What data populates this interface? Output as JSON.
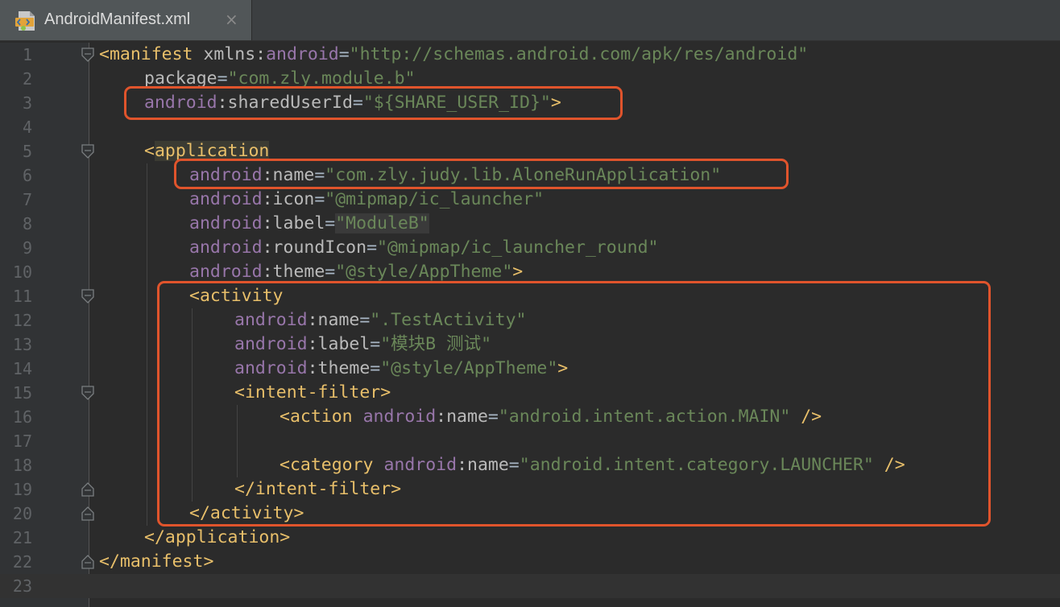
{
  "tab": {
    "label": "AndroidManifest.xml",
    "close": "×",
    "icon": "android-manifest-file-icon"
  },
  "colors": {
    "tag": "#e8bf6a",
    "namespace": "#9876aa",
    "attribute": "#bababa",
    "string": "#6a8759",
    "highlight_box": "#e0542c"
  },
  "lines": [
    {
      "num": "1",
      "indent": 0,
      "fold": "open",
      "tokens": [
        [
          "<manifest",
          "t"
        ],
        [
          " xmlns:",
          "a"
        ],
        [
          "android",
          "n"
        ],
        [
          "=",
          "p"
        ],
        [
          "\"http://schemas.android.com/apk/res/android\"",
          "s"
        ]
      ]
    },
    {
      "num": "2",
      "indent": 1,
      "fold": "",
      "tokens": [
        [
          "package",
          "a"
        ],
        [
          "=",
          "p"
        ],
        [
          "\"com.zly.module.b\"",
          "s"
        ]
      ]
    },
    {
      "num": "3",
      "indent": 1,
      "fold": "",
      "tokens": [
        [
          "android",
          "n"
        ],
        [
          ":sharedUserId",
          "a"
        ],
        [
          "=",
          "p"
        ],
        [
          "\"${SHARE_USER_ID}\"",
          "s"
        ],
        [
          ">",
          "t"
        ]
      ]
    },
    {
      "num": "4",
      "indent": 0,
      "fold": "",
      "tokens": []
    },
    {
      "num": "5",
      "indent": 1,
      "fold": "open",
      "tokens": [
        [
          "<",
          "t"
        ],
        [
          "application",
          "t hl-tag"
        ]
      ]
    },
    {
      "num": "6",
      "indent": 2,
      "fold": "",
      "tokens": [
        [
          "android",
          "n"
        ],
        [
          ":name",
          "a"
        ],
        [
          "=",
          "p"
        ],
        [
          "\"com.zly.judy.lib.AloneRunApplication\"",
          "s"
        ]
      ]
    },
    {
      "num": "7",
      "indent": 2,
      "fold": "",
      "tokens": [
        [
          "android",
          "n"
        ],
        [
          ":icon",
          "a"
        ],
        [
          "=",
          "p"
        ],
        [
          "\"@mipmap/ic_launcher\"",
          "s"
        ]
      ]
    },
    {
      "num": "8",
      "indent": 2,
      "fold": "",
      "tokens": [
        [
          "android",
          "n"
        ],
        [
          ":label",
          "a"
        ],
        [
          "=",
          "p"
        ],
        [
          "\"ModuleB\"",
          "s hl-str"
        ]
      ]
    },
    {
      "num": "9",
      "indent": 2,
      "fold": "",
      "tokens": [
        [
          "android",
          "n"
        ],
        [
          ":roundIcon",
          "a"
        ],
        [
          "=",
          "p"
        ],
        [
          "\"@mipmap/ic_launcher_round\"",
          "s"
        ]
      ]
    },
    {
      "num": "10",
      "indent": 2,
      "fold": "",
      "tokens": [
        [
          "android",
          "n"
        ],
        [
          ":theme",
          "a"
        ],
        [
          "=",
          "p"
        ],
        [
          "\"@style/AppTheme\"",
          "s"
        ],
        [
          ">",
          "t"
        ]
      ]
    },
    {
      "num": "11",
      "indent": 2,
      "fold": "open",
      "tokens": [
        [
          "<activity",
          "t"
        ]
      ]
    },
    {
      "num": "12",
      "indent": 3,
      "fold": "",
      "tokens": [
        [
          "android",
          "n"
        ],
        [
          ":name",
          "a"
        ],
        [
          "=",
          "p"
        ],
        [
          "\".TestActivity\"",
          "s"
        ]
      ]
    },
    {
      "num": "13",
      "indent": 3,
      "fold": "",
      "tokens": [
        [
          "android",
          "n"
        ],
        [
          ":label",
          "a"
        ],
        [
          "=",
          "p"
        ],
        [
          "\"模块B 测试\"",
          "s"
        ]
      ]
    },
    {
      "num": "14",
      "indent": 3,
      "fold": "",
      "tokens": [
        [
          "android",
          "n"
        ],
        [
          ":theme",
          "a"
        ],
        [
          "=",
          "p"
        ],
        [
          "\"@style/AppTheme\"",
          "s"
        ],
        [
          ">",
          "t"
        ]
      ]
    },
    {
      "num": "15",
      "indent": 3,
      "fold": "open",
      "tokens": [
        [
          "<intent-filter>",
          "t"
        ]
      ]
    },
    {
      "num": "16",
      "indent": 4,
      "fold": "",
      "tokens": [
        [
          "<action ",
          "t"
        ],
        [
          "android",
          "n"
        ],
        [
          ":name",
          "a"
        ],
        [
          "=",
          "p"
        ],
        [
          "\"android.intent.action.MAIN\"",
          "s"
        ],
        [
          " />",
          "t"
        ]
      ]
    },
    {
      "num": "17",
      "indent": 0,
      "fold": "",
      "tokens": []
    },
    {
      "num": "18",
      "indent": 4,
      "fold": "",
      "tokens": [
        [
          "<category ",
          "t"
        ],
        [
          "android",
          "n"
        ],
        [
          ":name",
          "a"
        ],
        [
          "=",
          "p"
        ],
        [
          "\"android.intent.category.LAUNCHER\"",
          "s"
        ],
        [
          " />",
          "t"
        ]
      ]
    },
    {
      "num": "19",
      "indent": 3,
      "fold": "close",
      "tokens": [
        [
          "</intent-filter>",
          "t"
        ]
      ]
    },
    {
      "num": "20",
      "indent": 2,
      "fold": "close",
      "tokens": [
        [
          "</activity>",
          "t"
        ]
      ]
    },
    {
      "num": "21",
      "indent": 1,
      "fold": "",
      "tokens": [
        [
          "</application>",
          "t"
        ]
      ]
    },
    {
      "num": "22",
      "indent": 0,
      "fold": "close",
      "tokens": [
        [
          "</manifest>",
          "t"
        ]
      ]
    },
    {
      "num": "23",
      "indent": 0,
      "fold": "",
      "tokens": [],
      "caret": true
    }
  ]
}
